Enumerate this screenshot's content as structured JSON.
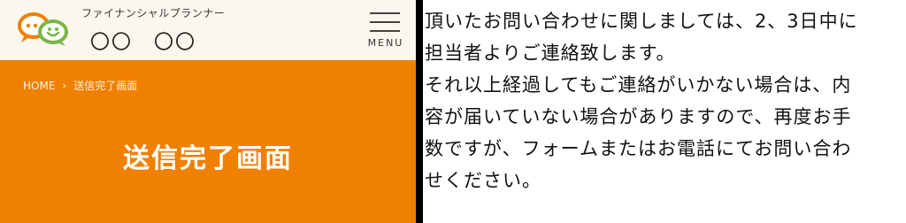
{
  "header": {
    "tagline": "ファイナンシャルプランナー",
    "firm_name": "〇〇　〇〇",
    "menu_label": "MENU"
  },
  "hero": {
    "breadcrumb": {
      "home": "HOME",
      "separator": "›",
      "current": "送信完了画面"
    },
    "title": "送信完了画面"
  },
  "message": {
    "lines": [
      "頂いたお問い合わせに関しましては、2、3日中に",
      "担当者よりご連絡致します。",
      "それ以上経過してもご連絡がいかない場合は、内",
      "容が届いていない場合がありますので、再度お手",
      "数ですが、フォームまたはお電話にてお問い合わ",
      "せください。"
    ]
  },
  "colors": {
    "accent_orange": "#f08000",
    "header_bg": "#fbf6ee",
    "logo_orange": "#f08000",
    "logo_green": "#7ab648"
  },
  "icons": {
    "logo": "speech-bubbles-logo-icon",
    "menu": "hamburger-menu-icon"
  }
}
